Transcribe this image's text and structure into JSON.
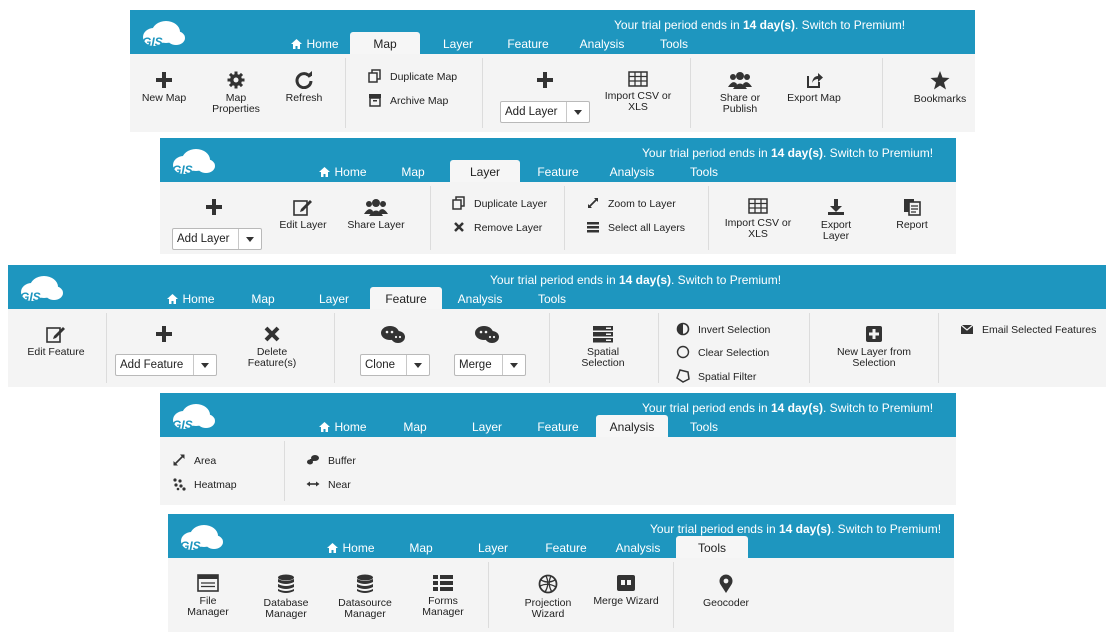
{
  "trial": {
    "prefix": "Your trial period ends in ",
    "days": "14 day(s)",
    "suffix": ". Switch to Premium!"
  },
  "logo": "GIS",
  "nav": {
    "home": "Home",
    "map": "Map",
    "layer": "Layer",
    "feature": "Feature",
    "analysis": "Analysis",
    "tools": "Tools"
  },
  "colors": {
    "header": "#1e96bf",
    "ribbon": "#f4f4f4",
    "text": "#222222"
  },
  "map_panel": {
    "active_tab": "Map",
    "new_map": "New Map",
    "map_properties": "Map Properties",
    "refresh": "Refresh",
    "duplicate_map": "Duplicate Map",
    "archive_map": "Archive Map",
    "add_layer": "Add Layer",
    "import_csv": "Import CSV or XLS",
    "share_publish": "Share or Publish",
    "export_map": "Export Map",
    "bookmarks": "Bookmarks"
  },
  "layer_panel": {
    "active_tab": "Layer",
    "add_layer": "Add Layer",
    "edit_layer": "Edit Layer",
    "share_layer": "Share Layer",
    "duplicate_layer": "Duplicate Layer",
    "remove_layer": "Remove Layer",
    "zoom_to_layer": "Zoom to Layer",
    "select_all_layers": "Select all Layers",
    "import_csv": "Import CSV or XLS",
    "export_layer": "Export Layer",
    "report": "Report"
  },
  "feature_panel": {
    "active_tab": "Feature",
    "edit_feature": "Edit Feature",
    "add_feature": "Add Feature",
    "delete_features": "Delete Feature(s)",
    "clone": "Clone",
    "merge": "Merge",
    "spatial_selection": "Spatial Selection",
    "invert_selection": "Invert Selection",
    "clear_selection": "Clear Selection",
    "spatial_filter": "Spatial Filter",
    "new_layer_from_selection": "New Layer from Selection",
    "email_selected": "Email Selected Features"
  },
  "analysis_panel": {
    "active_tab": "Analysis",
    "area": "Area",
    "heatmap": "Heatmap",
    "buffer": "Buffer",
    "near": "Near"
  },
  "tools_panel": {
    "active_tab": "Tools",
    "file_manager": "File Manager",
    "database_manager": "Database Manager",
    "datasource_manager": "Datasource Manager",
    "forms_manager": "Forms Manager",
    "projection_wizard": "Projection Wizard",
    "merge_wizard": "Merge Wizard",
    "geocoder": "Geocoder"
  }
}
